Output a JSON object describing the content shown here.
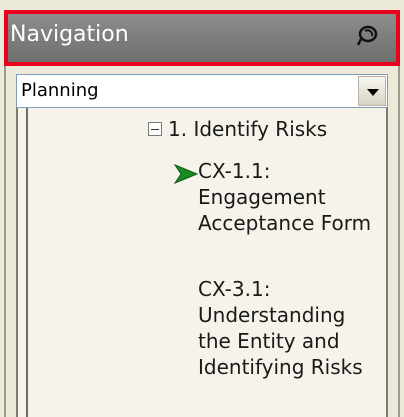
{
  "header": {
    "title": "Navigation",
    "pin_icon": "pin-icon",
    "highlight_color": "#e8001c"
  },
  "dropdown": {
    "value": "Planning"
  },
  "tree": {
    "section": {
      "label": "1. Identify  Risks",
      "expanded": true
    },
    "items": [
      {
        "lines": [
          "CX-1.1:",
          "Engagement",
          "Acceptance Form"
        ],
        "current": true,
        "current_icon": "green-arrow-icon"
      },
      {
        "lines": [
          "CX-3.1:",
          "Understanding",
          "the  Entity  and",
          "Identifying  Risks"
        ],
        "current": false
      }
    ]
  }
}
